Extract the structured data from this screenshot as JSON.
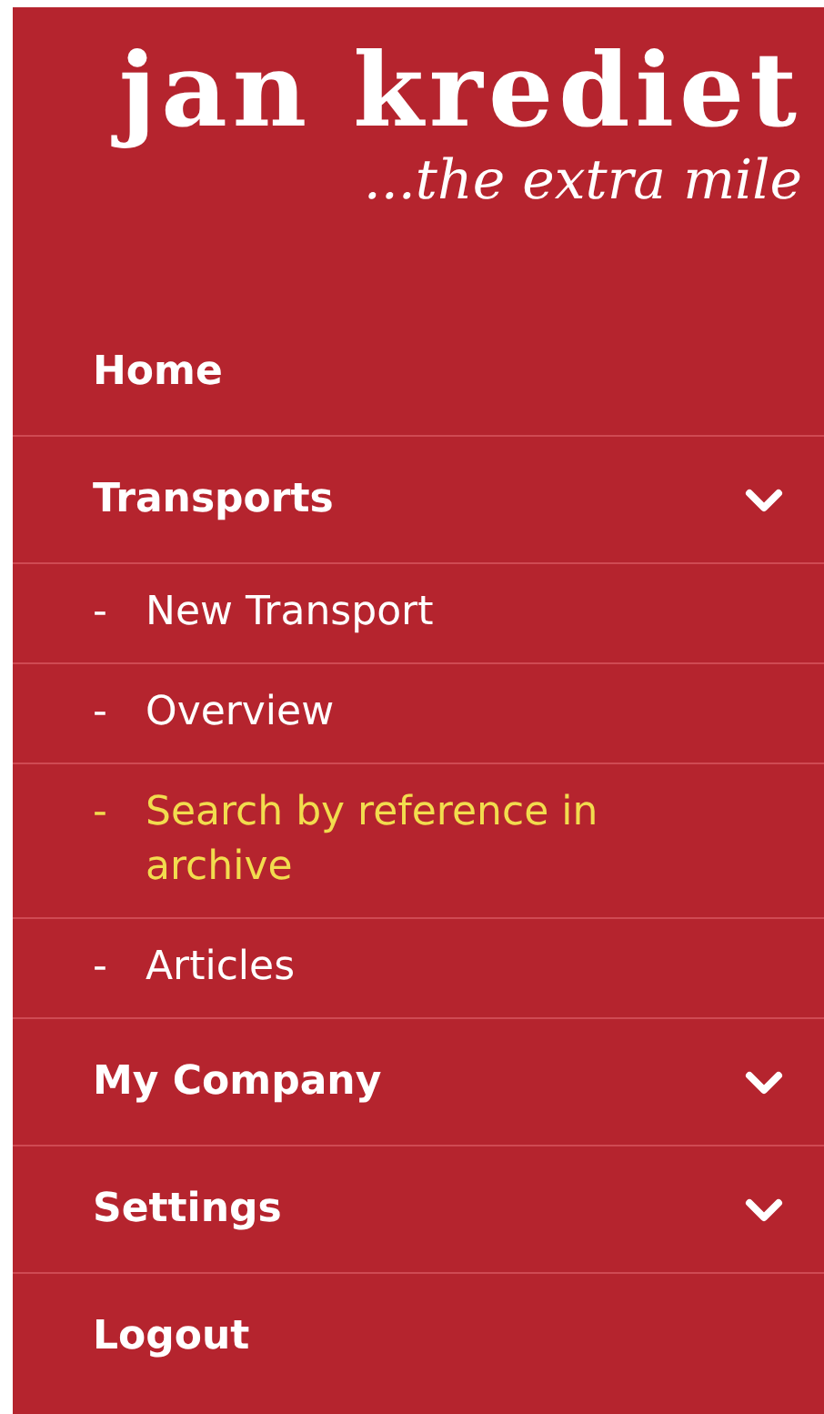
{
  "logo": {
    "name": "jan krediet",
    "tagline": "...the extra mile"
  },
  "menu": [
    {
      "kind": "link",
      "label": "Home"
    },
    {
      "kind": "group",
      "label": "Transports",
      "children": [
        {
          "marker": "-",
          "label": "New Transport",
          "selected": false
        },
        {
          "marker": "-",
          "label": "Overview",
          "selected": false
        },
        {
          "marker": "-",
          "label": "Search by reference in archive",
          "selected": true
        },
        {
          "marker": "-",
          "label": "Articles",
          "selected": false
        }
      ]
    },
    {
      "kind": "group",
      "label": "My Company"
    },
    {
      "kind": "group",
      "label": "Settings"
    },
    {
      "kind": "link",
      "label": "Logout"
    }
  ]
}
